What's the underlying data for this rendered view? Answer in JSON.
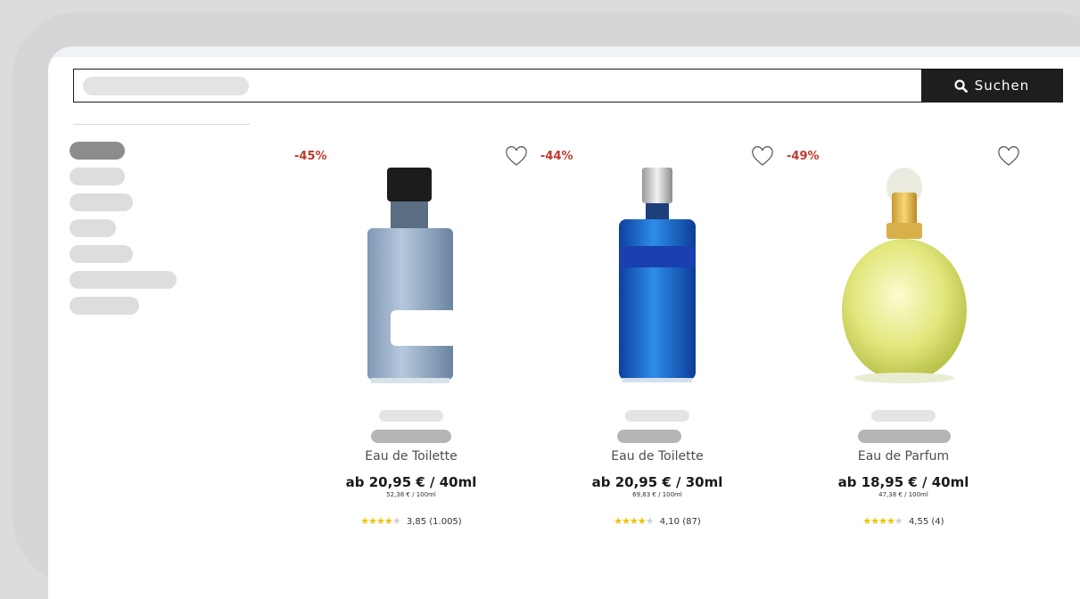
{
  "search": {
    "button_label": "Suchen",
    "icon": "search-icon"
  },
  "sidebar": {
    "items": [
      "",
      "",
      "",
      "",
      "",
      "",
      ""
    ]
  },
  "products": [
    {
      "discount": "-45%",
      "type": "Eau de Toilette",
      "price": "ab 20,95 € / 40ml",
      "unit_price": "52,38 € / 100ml",
      "rating_value": 3.85,
      "rating_text": "3,85",
      "rating_count": "(1.005)",
      "bottle_color": "#9fb6cf"
    },
    {
      "discount": "-44%",
      "type": "Eau de Toilette",
      "price": "ab 20,95 € / 30ml",
      "unit_price": "69,83 € / 100ml",
      "rating_value": 4.1,
      "rating_text": "4,10",
      "rating_count": "(87)",
      "bottle_color": "#1f6fd6"
    },
    {
      "discount": "-49%",
      "type": "Eau de Parfum",
      "price": "ab 18,95 € / 40ml",
      "unit_price": "47,38 € / 100ml",
      "rating_value": 4.55,
      "rating_text": "4,55",
      "rating_count": "(4)",
      "bottle_color": "#e3e88a"
    }
  ],
  "colors": {
    "discount": "#c0392b",
    "search_button": "#1e1e1e",
    "stars": "#f2c200"
  }
}
